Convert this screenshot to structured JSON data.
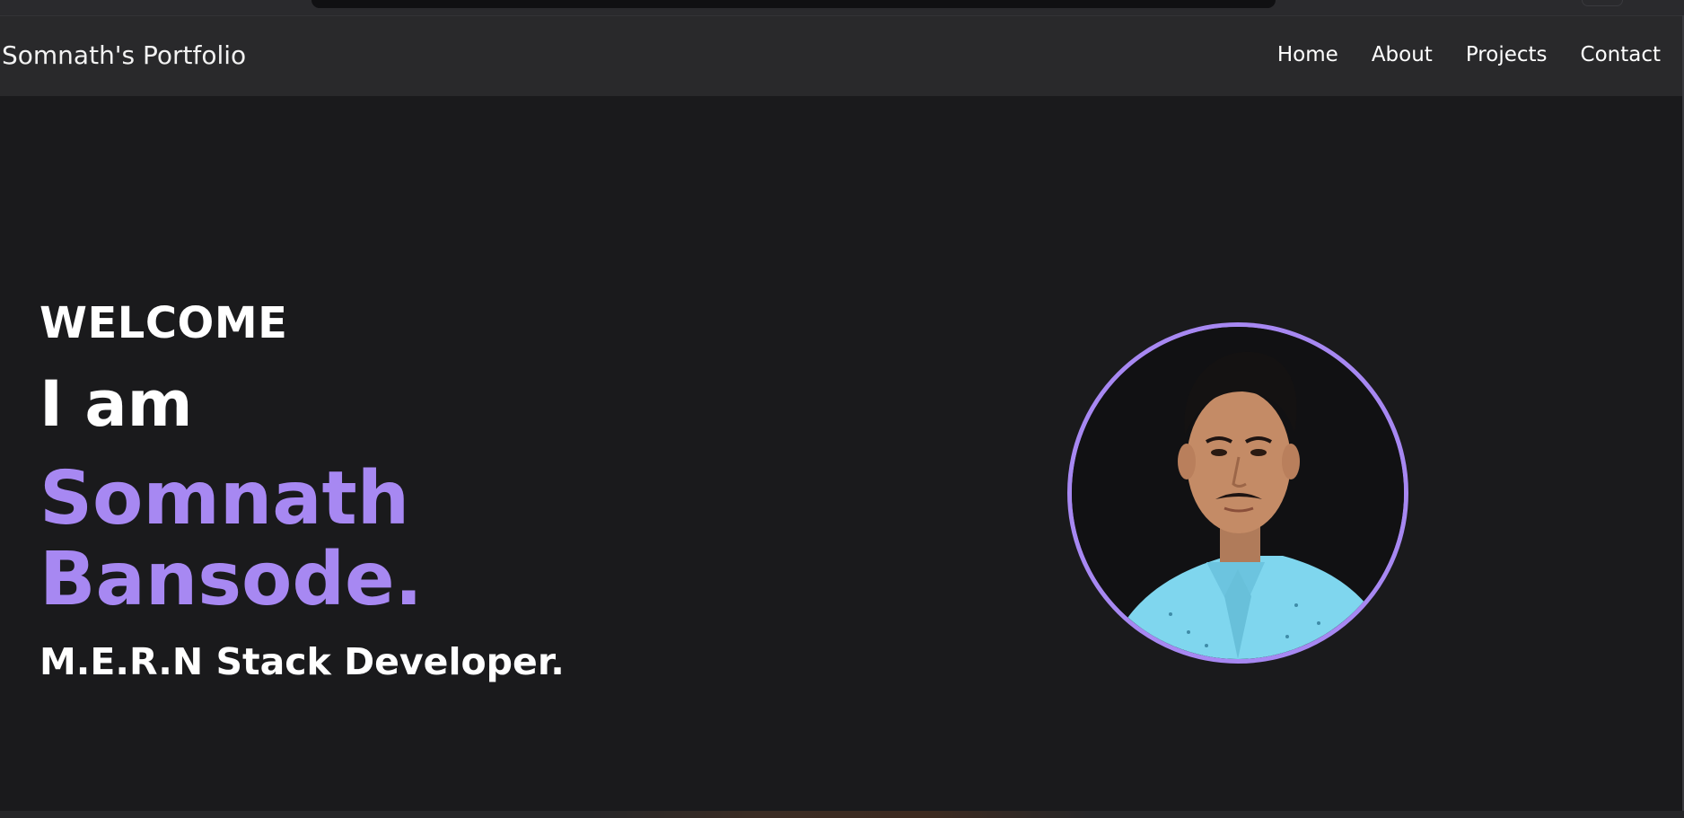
{
  "navbar": {
    "brand": "Somnath's Portfolio",
    "links": [
      {
        "label": "Home"
      },
      {
        "label": "About"
      },
      {
        "label": "Projects"
      },
      {
        "label": "Contact"
      }
    ]
  },
  "hero": {
    "welcome": "WELCOME",
    "intro": "I am",
    "first_name": "Somnath",
    "last_name": "Bansode.",
    "role": "M.E.R.N Stack Developer.",
    "avatar_icon": "profile-photo"
  },
  "colors": {
    "background": "#1a1a1c",
    "navbar": "#29292b",
    "accent": "#a788f2",
    "text": "#ffffff"
  }
}
